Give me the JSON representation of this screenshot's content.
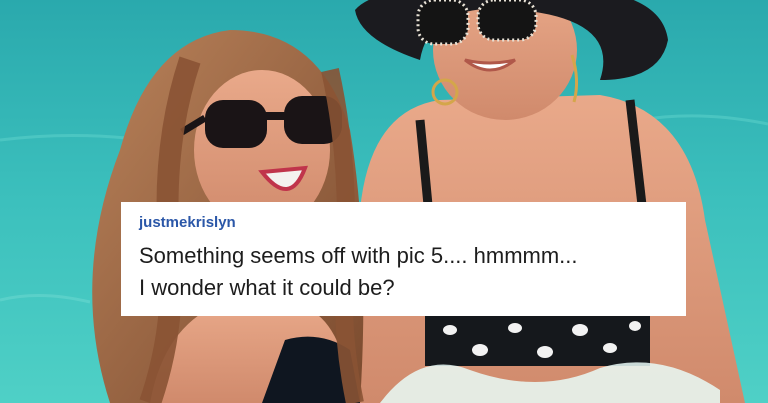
{
  "comment": {
    "username": "justmekrislyn",
    "text": "Something seems off with pic 5.... hmmmm...\nI wonder what it could be?"
  },
  "colors": {
    "water": "#2fb3b4",
    "username": "#2b57a8",
    "card": "#ffffff",
    "text": "#1d1d1d"
  }
}
